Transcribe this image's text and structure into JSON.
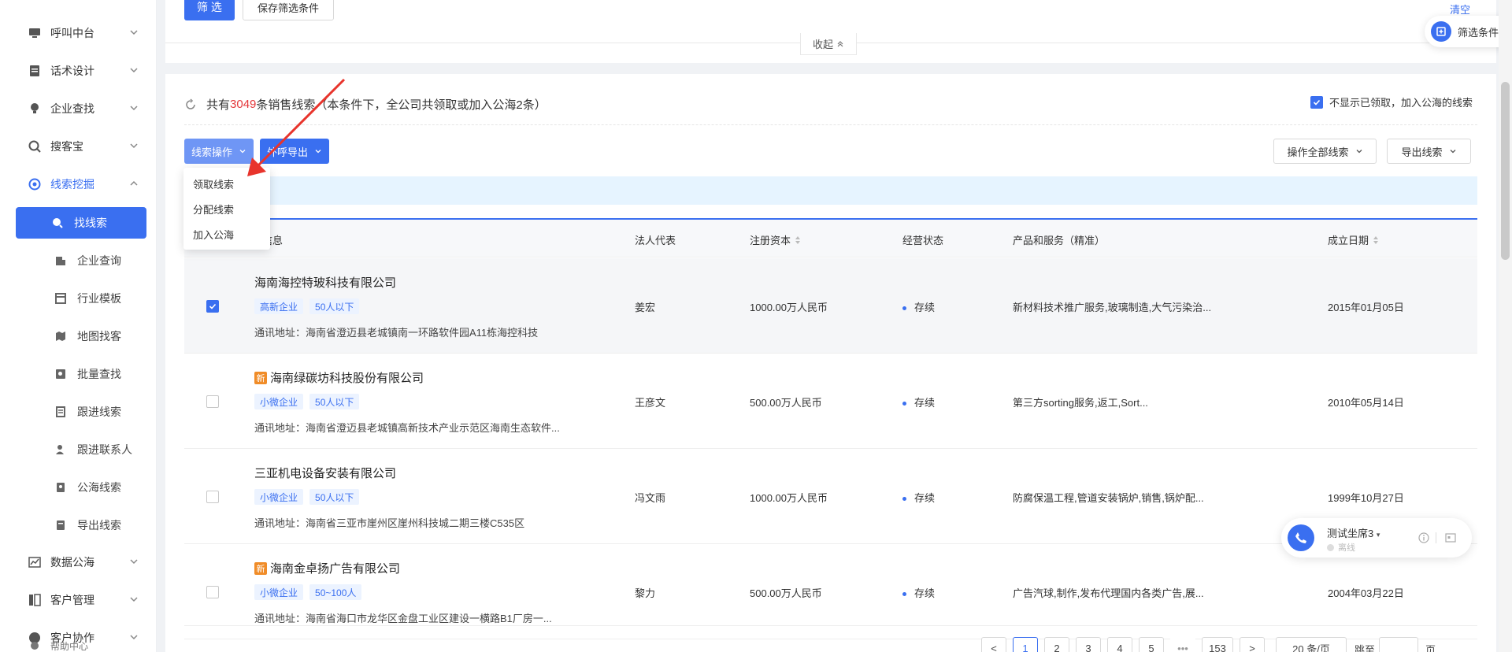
{
  "sidebar": {
    "items": [
      {
        "label": "呼叫中台",
        "icon": "monitor-icon"
      },
      {
        "label": "话术设计",
        "icon": "document-icon"
      },
      {
        "label": "企业查找",
        "icon": "bulb-icon"
      },
      {
        "label": "搜客宝",
        "icon": "search-circle-icon"
      },
      {
        "label": "线索挖掘",
        "icon": "target-icon"
      }
    ],
    "sub_items": [
      {
        "label": "找线索",
        "icon": "search-icon"
      },
      {
        "label": "企业查询",
        "icon": "building-icon"
      },
      {
        "label": "行业模板",
        "icon": "template-icon"
      },
      {
        "label": "地图找客",
        "icon": "map-icon"
      },
      {
        "label": "批量查找",
        "icon": "batch-search-icon"
      },
      {
        "label": "跟进线索",
        "icon": "follow-icon"
      },
      {
        "label": "跟进联系人",
        "icon": "contact-icon"
      },
      {
        "label": "公海线索",
        "icon": "pool-icon"
      },
      {
        "label": "导出线索",
        "icon": "export-icon"
      }
    ],
    "lower_items": [
      {
        "label": "数据公海",
        "icon": "chart-icon"
      },
      {
        "label": "客户管理",
        "icon": "customer-icon"
      },
      {
        "label": "客户协作",
        "icon": "collab-icon"
      }
    ],
    "footer_label": "帮助中心"
  },
  "filter": {
    "filter_button": "筛 选",
    "save_button": "保存筛选条件",
    "clear_link": "清空",
    "collapse_label": "收起",
    "float_label": "筛选条件"
  },
  "summary": {
    "prefix": "共有",
    "count": "3049",
    "suffix": "条销售线索（本条件下，全公司共领取或加入公海2条）",
    "hide_option": "不显示已领取，加入公海的线索"
  },
  "toolbar": {
    "lead_ops": "线索操作",
    "call_export": "外呼导出",
    "op_all": "操作全部线索",
    "export_leads": "导出线索"
  },
  "menu": {
    "items": [
      "领取线索",
      "分配线索",
      "加入公海"
    ]
  },
  "table": {
    "headers": {
      "company": "企业信息",
      "legal": "法人代表",
      "capital": "注册资本",
      "status": "经营状态",
      "products": "产品和服务（精准）",
      "date": "成立日期"
    },
    "rows": [
      {
        "name": "海南海控特玻科技有限公司",
        "new": false,
        "new_label": "",
        "tags": [
          "高新企业",
          "50人以下"
        ],
        "address": "通讯地址：海南省澄迈县老城镇南一环路软件园A11栋海控科技",
        "legal": "姜宏",
        "capital": "1000.00万人民币",
        "status": "存续",
        "products": "新材料技术推广服务,玻璃制造,大气污染治...",
        "date": "2015年01月05日"
      },
      {
        "name": "海南绿碳坊科技股份有限公司",
        "new": true,
        "new_label": "新",
        "tags": [
          "小微企业",
          "50人以下"
        ],
        "address": "通讯地址：海南省澄迈县老城镇高新技术产业示范区海南生态软件...",
        "legal": "王彦文",
        "capital": "500.00万人民币",
        "status": "存续",
        "products": "第三方sorting服务,返工,Sort...",
        "date": "2010年05月14日"
      },
      {
        "name": "三亚机电设备安装有限公司",
        "new": false,
        "new_label": "",
        "tags": [
          "小微企业",
          "50人以下"
        ],
        "address": "通讯地址：海南省三亚市崖州区崖州科技城二期三楼C535区",
        "legal": "冯文雨",
        "capital": "1000.00万人民币",
        "status": "存续",
        "products": "防腐保温工程,管道安装锅炉,销售,锅炉配...",
        "date": "1999年10月27日"
      },
      {
        "name": "海南金卓扬广告有限公司",
        "new": true,
        "new_label": "新",
        "tags": [
          "小微企业",
          "50~100人"
        ],
        "address": "通讯地址：海南省海口市龙华区金盘工业区建设一横路B1厂房一...",
        "legal": "黎力",
        "capital": "500.00万人民币",
        "status": "存续",
        "products": "广告汽球,制作,发布代理国内各类广告,展...",
        "date": "2004年03月22日"
      }
    ]
  },
  "pagination": {
    "prev": "<",
    "pages": [
      "1",
      "2",
      "3",
      "4",
      "5",
      "•••",
      "153"
    ],
    "next": ">",
    "per_page": "20 条/页",
    "jump_label": "跳至",
    "page_unit": "页"
  },
  "phone": {
    "title": "测试坐席3",
    "status": "离线"
  },
  "colors": {
    "accent": "#3a6ff0",
    "count_red": "#e4393c",
    "arrow_red": "#e8342c"
  }
}
